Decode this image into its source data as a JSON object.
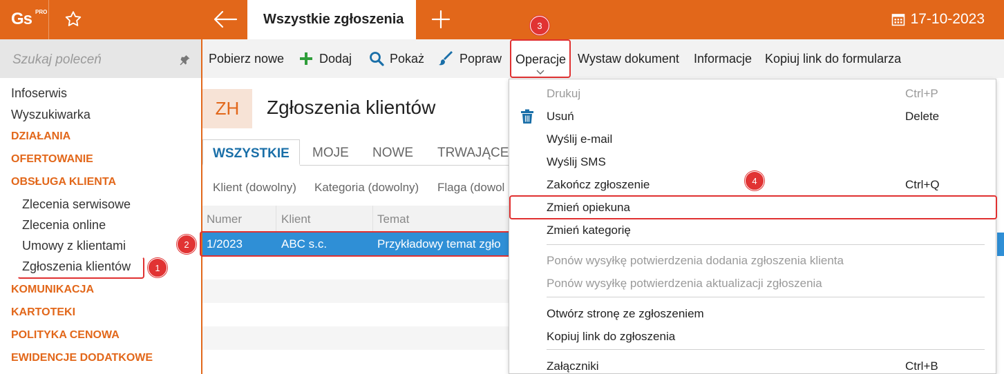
{
  "app": {
    "logo_text": "Gs",
    "logo_badge": "PRO",
    "active_tab": "Wszystkie zgłoszenia",
    "date": "17-10-2023"
  },
  "sidebar": {
    "search_placeholder": "Szukaj poleceń",
    "items": [
      {
        "label": "Infoserwis",
        "kind": "plain"
      },
      {
        "label": "Wyszukiwarka",
        "kind": "plain"
      },
      {
        "label": "DZIAŁANIA",
        "kind": "section"
      },
      {
        "label": "OFERTOWANIE",
        "kind": "section"
      },
      {
        "label": "OBSŁUGA KLIENTA",
        "kind": "section"
      },
      {
        "label": "Zlecenia serwisowe",
        "kind": "sub"
      },
      {
        "label": "Zlecenia online",
        "kind": "sub"
      },
      {
        "label": "Umowy z klientami",
        "kind": "sub"
      },
      {
        "label": "Zgłoszenia klientów",
        "kind": "sub"
      },
      {
        "label": "KOMUNIKACJA",
        "kind": "section"
      },
      {
        "label": "KARTOTEKI",
        "kind": "section"
      },
      {
        "label": "POLITYKA CENOWA",
        "kind": "section"
      },
      {
        "label": "EWIDENCJE DODATKOWE",
        "kind": "section"
      }
    ]
  },
  "toolbar": {
    "fetch_new": "Pobierz nowe",
    "add": "Dodaj",
    "show": "Pokaż",
    "edit": "Popraw",
    "operations": "Operacje",
    "issue_document": "Wystaw dokument",
    "information": "Informacje",
    "copy_form_link": "Kopiuj link do formularza"
  },
  "page": {
    "badge": "ZH",
    "title": "Zgłoszenia klientów",
    "tabs": [
      "WSZYSTKIE",
      "MOJE",
      "NOWE",
      "TRWAJĄCE"
    ],
    "filters": [
      "Klient (dowolny)",
      "Kategoria (dowolny)",
      "Flaga (dowol"
    ],
    "columns": [
      "Numer",
      "Klient",
      "Temat"
    ],
    "rows": [
      {
        "numer": "1/2023",
        "klient": "ABC s.c.",
        "temat": "Przykładowy temat zgło"
      }
    ]
  },
  "menu": {
    "items": [
      {
        "label": "Drukuj",
        "shortcut": "Ctrl+P",
        "disabled": true
      },
      {
        "label": "Usuń",
        "shortcut": "Delete",
        "disabled": false,
        "icon": "trash-icon"
      },
      {
        "label": "Wyślij e-mail",
        "shortcut": "",
        "disabled": false
      },
      {
        "label": "Wyślij SMS",
        "shortcut": "",
        "disabled": false
      },
      {
        "label": "Zakończ zgłoszenie",
        "shortcut": "Ctrl+Q",
        "disabled": false
      },
      {
        "label": "Zmień opiekuna",
        "shortcut": "",
        "disabled": false
      },
      {
        "label": "Zmień kategorię",
        "shortcut": "",
        "disabled": false
      },
      {
        "label": "Ponów wysyłkę potwierdzenia dodania zgłoszenia klienta",
        "shortcut": "",
        "disabled": true
      },
      {
        "label": "Ponów wysyłkę potwierdzenia aktualizacji zgłoszenia",
        "shortcut": "",
        "disabled": true
      },
      {
        "label": "Otwórz stronę ze zgłoszeniem",
        "shortcut": "",
        "disabled": false
      },
      {
        "label": "Kopiuj link do zgłoszenia",
        "shortcut": "",
        "disabled": false
      },
      {
        "label": "Załączniki",
        "shortcut": "Ctrl+B",
        "disabled": false
      }
    ]
  },
  "annotations": {
    "b1": "1",
    "b2": "2",
    "b3": "3",
    "b4": "4"
  },
  "colors": {
    "brand": "#e2671a",
    "selection": "#2f8fd6",
    "annotation": "#e13333",
    "tab_active": "#1a6fa8"
  }
}
